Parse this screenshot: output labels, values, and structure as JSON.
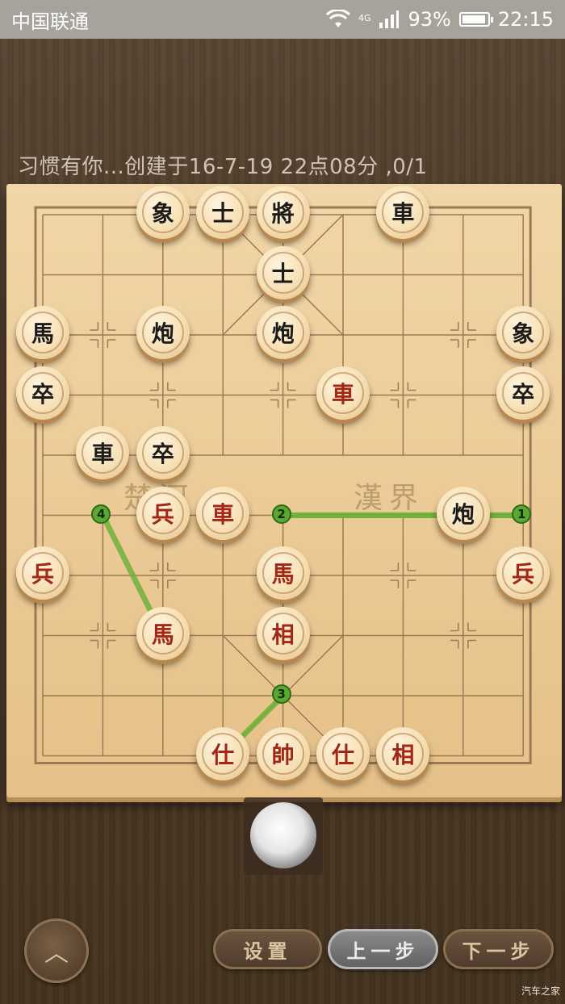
{
  "status_bar": {
    "carrier": "中国联通",
    "network": "4G",
    "battery": "93%",
    "time": "22:15"
  },
  "game_info": "习惯有你...创建于16-7-19 22点08分    ,0/1",
  "river": {
    "left": "楚河",
    "right": "漢界"
  },
  "pieces": [
    {
      "id": "b-xiang-1",
      "label": "象",
      "side": "black",
      "col": 2,
      "row": 0
    },
    {
      "id": "b-shi-1",
      "label": "士",
      "side": "black",
      "col": 3,
      "row": 0
    },
    {
      "id": "b-jiang",
      "label": "將",
      "side": "black",
      "col": 4,
      "row": 0
    },
    {
      "id": "b-che-1",
      "label": "車",
      "side": "black",
      "col": 6,
      "row": 0
    },
    {
      "id": "b-shi-2",
      "label": "士",
      "side": "black",
      "col": 4,
      "row": 1
    },
    {
      "id": "b-ma-1",
      "label": "馬",
      "side": "black",
      "col": 0,
      "row": 2
    },
    {
      "id": "b-pao-1",
      "label": "炮",
      "side": "black",
      "col": 2,
      "row": 2
    },
    {
      "id": "b-pao-2",
      "label": "炮",
      "side": "black",
      "col": 4,
      "row": 2
    },
    {
      "id": "b-xiang-2",
      "label": "象",
      "side": "black",
      "col": 8,
      "row": 2
    },
    {
      "id": "b-zu-1",
      "label": "卒",
      "side": "black",
      "col": 0,
      "row": 3
    },
    {
      "id": "r-che-1",
      "label": "車",
      "side": "red",
      "col": 5,
      "row": 3
    },
    {
      "id": "b-zu-2",
      "label": "卒",
      "side": "black",
      "col": 8,
      "row": 3
    },
    {
      "id": "b-che-2",
      "label": "車",
      "side": "black",
      "col": 1,
      "row": 4
    },
    {
      "id": "b-zu-3",
      "label": "卒",
      "side": "black",
      "col": 2,
      "row": 4
    },
    {
      "id": "r-bing-1",
      "label": "兵",
      "side": "red",
      "col": 2,
      "row": 5
    },
    {
      "id": "r-che-2",
      "label": "車",
      "side": "red",
      "col": 3,
      "row": 5
    },
    {
      "id": "b-pao-3",
      "label": "炮",
      "side": "black",
      "col": 7,
      "row": 5
    },
    {
      "id": "r-bing-2",
      "label": "兵",
      "side": "red",
      "col": 0,
      "row": 6
    },
    {
      "id": "r-ma-1",
      "label": "馬",
      "side": "red",
      "col": 4,
      "row": 6
    },
    {
      "id": "r-bing-3",
      "label": "兵",
      "side": "red",
      "col": 8,
      "row": 6
    },
    {
      "id": "r-ma-2",
      "label": "馬",
      "side": "red",
      "col": 2,
      "row": 7
    },
    {
      "id": "r-xiang-1",
      "label": "相",
      "side": "red",
      "col": 4,
      "row": 7
    },
    {
      "id": "r-shi-1",
      "label": "仕",
      "side": "red",
      "col": 3,
      "row": 9
    },
    {
      "id": "r-shuai",
      "label": "帥",
      "side": "red",
      "col": 4,
      "row": 9
    },
    {
      "id": "r-shi-2",
      "label": "仕",
      "side": "red",
      "col": 5,
      "row": 9
    },
    {
      "id": "r-xiang-2",
      "label": "相",
      "side": "red",
      "col": 6,
      "row": 9
    }
  ],
  "move_hints": [
    {
      "label": "1",
      "from": {
        "col": 8,
        "row": 5
      },
      "to": {
        "col": 4,
        "row": 5
      },
      "marker": {
        "col": 8,
        "row": 5
      }
    },
    {
      "label": "2",
      "from": {
        "col": 4,
        "row": 5
      },
      "to": {
        "col": 8,
        "row": 5
      },
      "marker": {
        "col": 4,
        "row": 5
      }
    },
    {
      "label": "3",
      "from": {
        "col": 4,
        "row": 8
      },
      "to": {
        "col": 3,
        "row": 9
      },
      "marker": {
        "col": 4,
        "row": 8
      }
    },
    {
      "label": "4",
      "from": {
        "col": 1,
        "row": 5
      },
      "to": {
        "col": 2,
        "row": 7
      },
      "marker": {
        "col": 1,
        "row": 5
      }
    }
  ],
  "controls": {
    "settings": "设置",
    "prev": "上一步",
    "next": "下一步"
  },
  "colors": {
    "hint_line": "#6fb23b",
    "red_piece_text": "#a42615",
    "black_piece_text": "#1d1b1a"
  },
  "watermark": "汽车之家"
}
